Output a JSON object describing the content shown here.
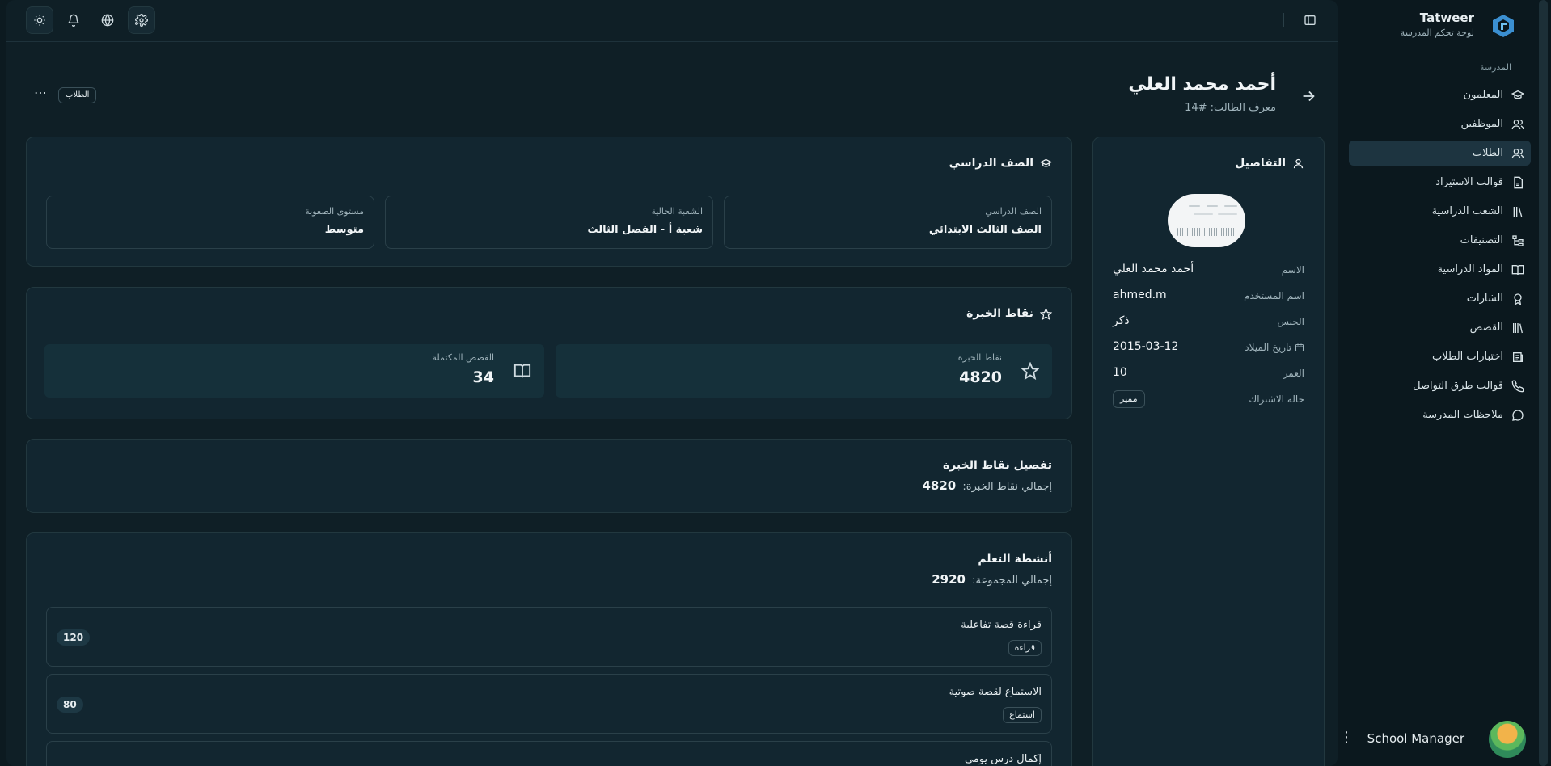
{
  "brand": {
    "name": "Tatweer",
    "subtitle": "لوحة تحكم المدرسة"
  },
  "sidebar": {
    "section_label": "المدرسة",
    "items": [
      {
        "label": "المعلمون",
        "icon": "graduation-cap-icon"
      },
      {
        "label": "الموظفين",
        "icon": "users-icon"
      },
      {
        "label": "الطلاب",
        "icon": "users-icon",
        "active": true
      },
      {
        "label": "قوالب الاستيراد",
        "icon": "file-icon"
      },
      {
        "label": "الشعب الدراسية",
        "icon": "library-icon"
      },
      {
        "label": "التصنيفات",
        "icon": "tree-icon"
      },
      {
        "label": "المواد الدراسية",
        "icon": "book-open-icon"
      },
      {
        "label": "الشارات",
        "icon": "award-icon"
      },
      {
        "label": "القصص",
        "icon": "books-icon"
      },
      {
        "label": "اختبارات الطلاب",
        "icon": "quiz-icon"
      },
      {
        "label": "قوالب طرق التواصل",
        "icon": "phone-icon"
      },
      {
        "label": "ملاحظات المدرسة",
        "icon": "message-icon"
      }
    ]
  },
  "user": {
    "name": "School Manager"
  },
  "header": {
    "title": "أحمد محمد العلي",
    "student_id": "معرف الطالب: #14",
    "breadcrumb_badge": "الطلاب"
  },
  "details": {
    "title": "التفاصيل",
    "rows": [
      {
        "key": "الاسم",
        "value": "أحمد محمد العلي"
      },
      {
        "key": "اسم المستخدم",
        "value": "ahmed.m"
      },
      {
        "key": "الجنس",
        "value": "ذكر"
      },
      {
        "key": "تاريخ الميلاد",
        "value": "2015-03-12"
      },
      {
        "key": "العمر",
        "value": "10"
      },
      {
        "key": "حالة الاشتراك",
        "value": "مميز"
      }
    ]
  },
  "grade": {
    "title": "الصف الدراسي",
    "boxes": [
      {
        "label": "الصف الدراسي",
        "value": "الصف الثالث الابتدائي"
      },
      {
        "label": "الشعبة الحالية",
        "value": "شعبة أ - الفصل الثالث"
      },
      {
        "label": "مستوى الصعوبة",
        "value": "متوسط"
      }
    ]
  },
  "xp": {
    "title": "نقاط الخبرة",
    "stats": [
      {
        "label": "نقاط الخبرة",
        "value": "4820"
      },
      {
        "label": "القصص المكتملة",
        "value": "34"
      }
    ]
  },
  "xp_breakdown": {
    "title": "تفصيل نقاط الخبرة",
    "total_label": "إجمالي نقاط الخبرة:",
    "total": "4820"
  },
  "activities": {
    "title": "أنشطة التعلم",
    "total_label": "إجمالي المجموعة:",
    "total": "2920",
    "items": [
      {
        "title": "قراءة قصة تفاعلية",
        "tag": "قراءة",
        "points": "120"
      },
      {
        "title": "الاستماع لقصة صوتية",
        "tag": "استماع",
        "points": "80"
      },
      {
        "title": "إكمال درس يومي",
        "tag": "",
        "points": ""
      }
    ]
  }
}
